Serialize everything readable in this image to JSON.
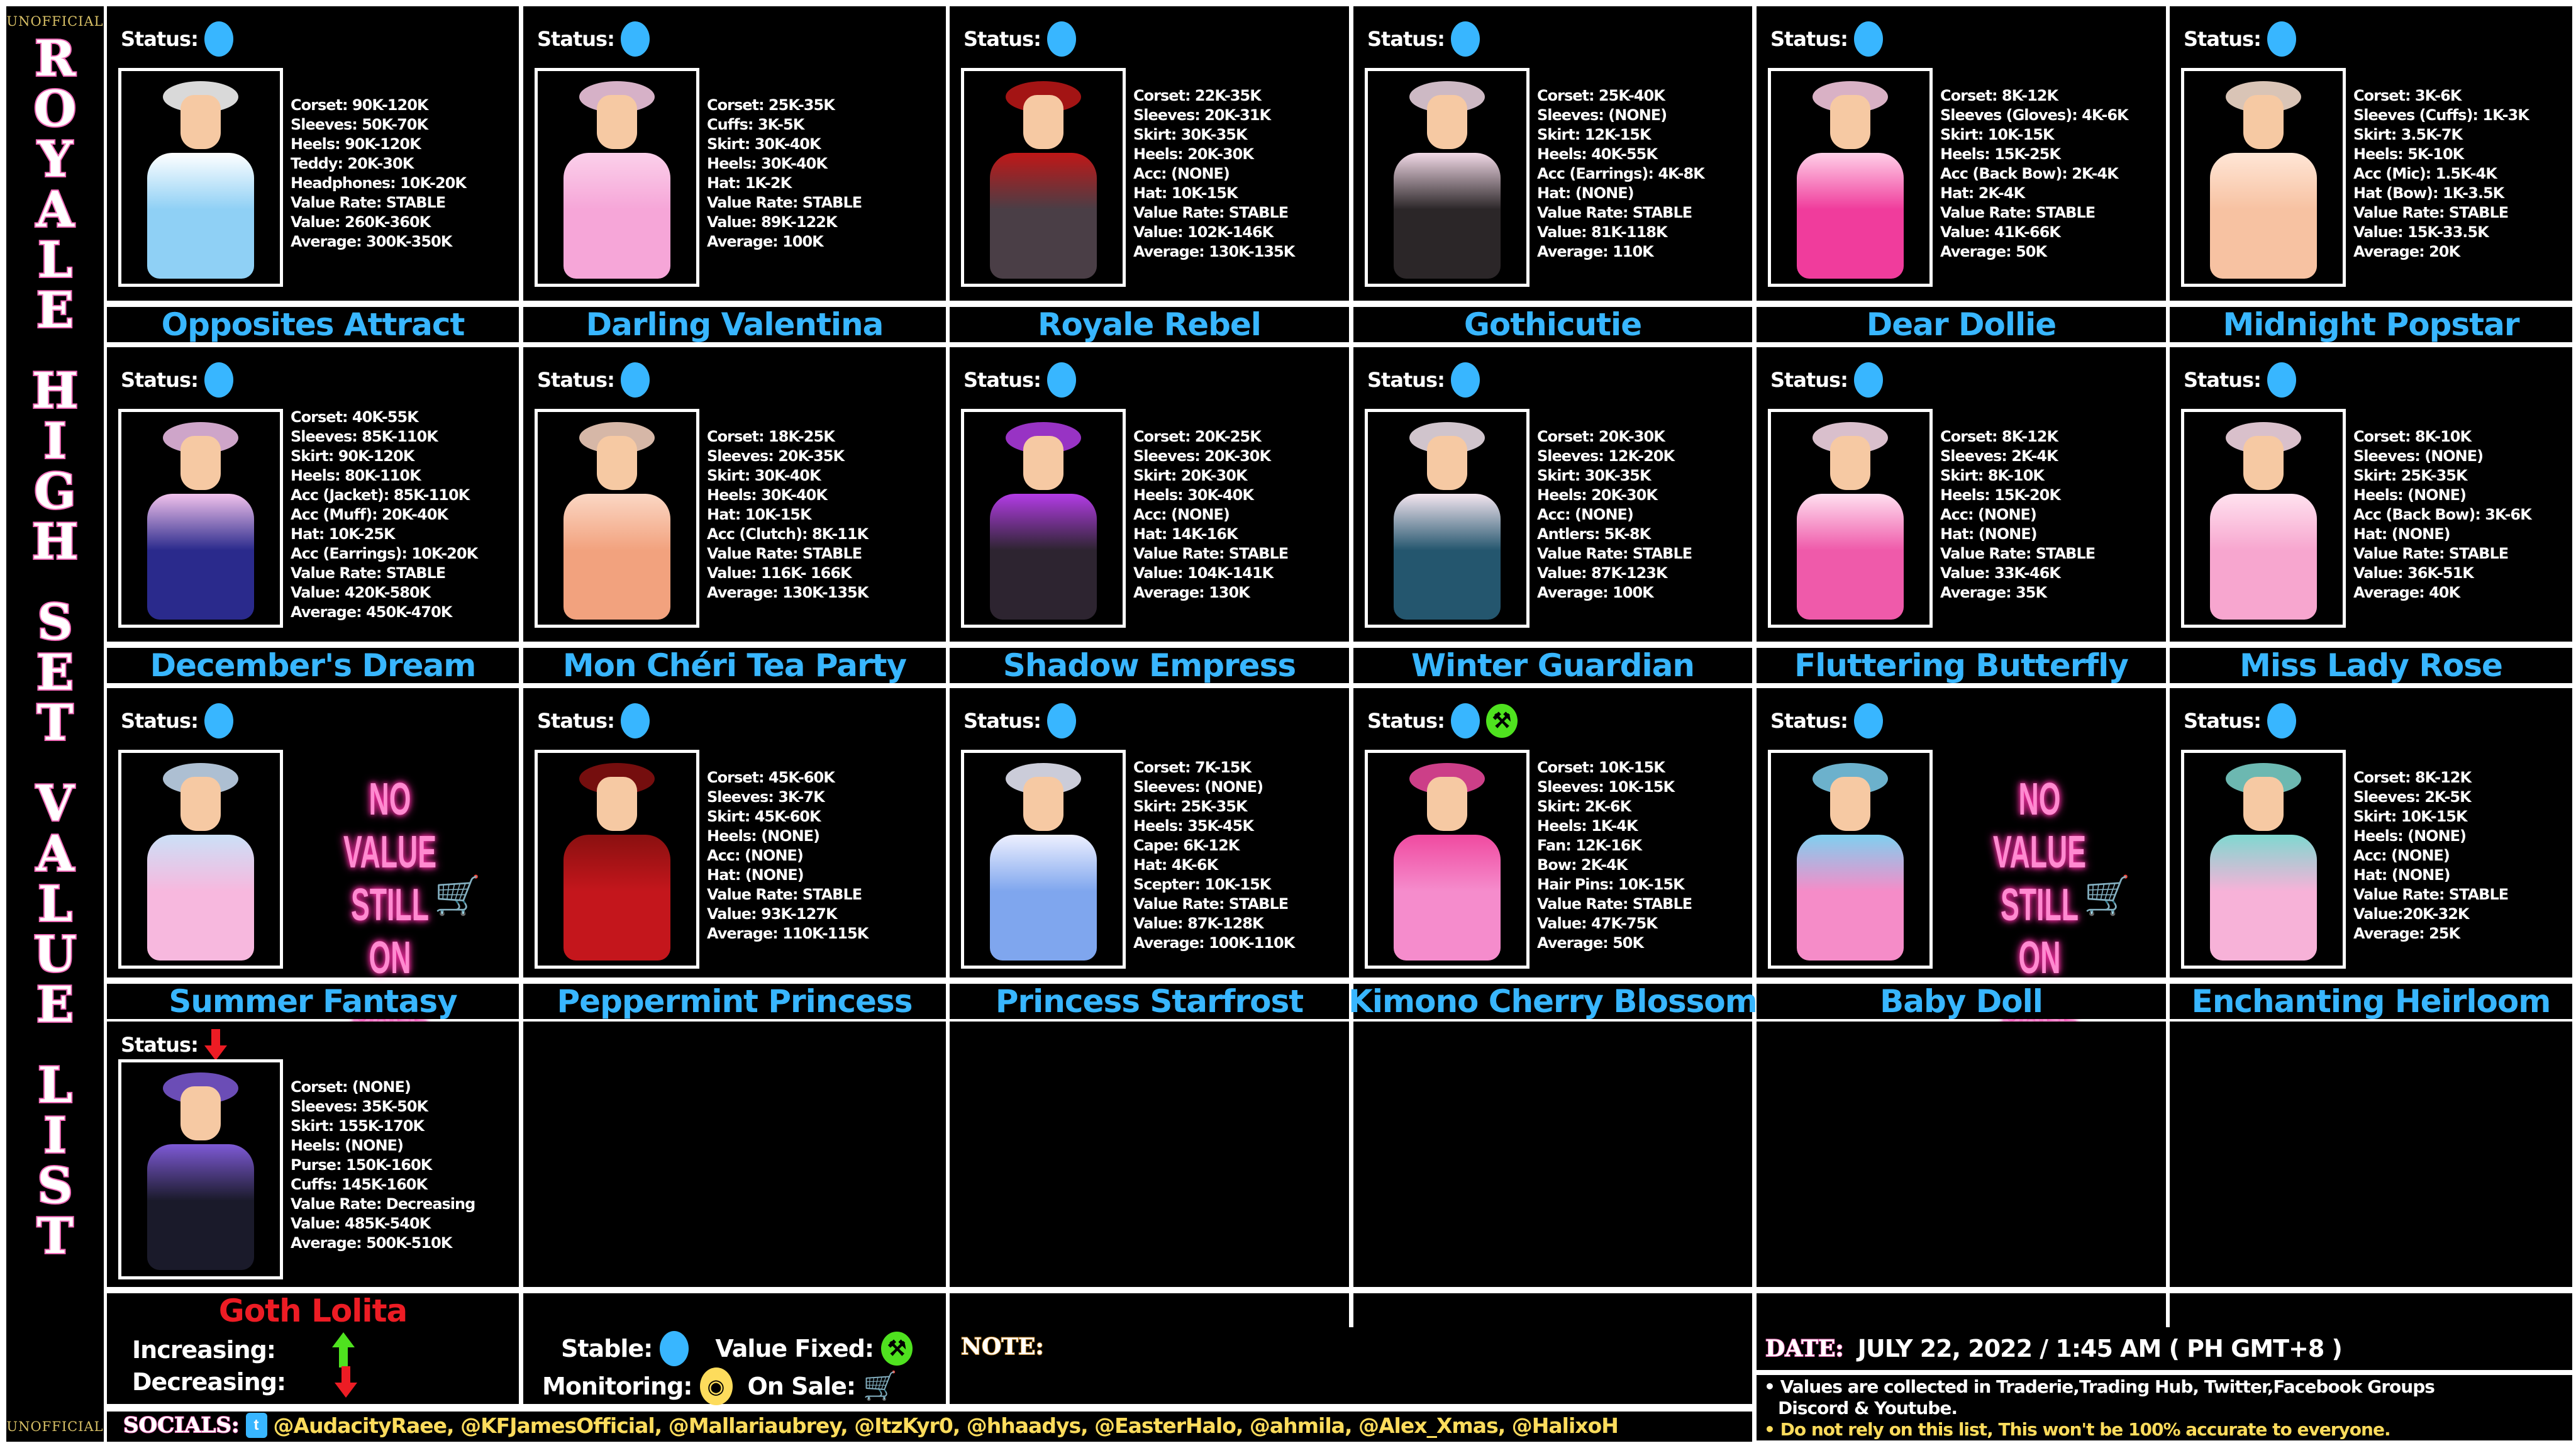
{
  "sidebar": {
    "top_label": "UNOFFICIAL",
    "bottom_label": "UNOFFICIAL",
    "title_words": [
      "ROYALE",
      "HIGH",
      "SET",
      "VALUE",
      "LIST"
    ]
  },
  "status_label": "Status:",
  "colors": {
    "stable": "#38b6ff",
    "value_fixed": "#4fe21f",
    "monitoring": "#fddc5c",
    "on_sale": "#fddc5c",
    "increasing": "#4fe21f",
    "decreasing": "#ed1c24",
    "set_name": "#38b6ff",
    "set_name_decreasing": "#ed1c24",
    "title_outline": "#f06ab8",
    "no_value_text": "#ff8ad0"
  },
  "no_value_text": [
    "NO VALUE",
    "STILL ON",
    "SALE"
  ],
  "sets": [
    {
      "name": "Opposites Attract",
      "status": [
        "stable"
      ],
      "outfit_colors": [
        "#8fd0f5",
        "#ffffff"
      ],
      "stats": [
        "Corset: 90K-120K",
        "Sleeves: 50K-70K",
        "Heels: 90K-120K",
        "Teddy: 20K-30K",
        "Headphones: 10K-20K",
        "Value Rate: STABLE",
        "Value: 260K-360K",
        "Average: 300K-350K"
      ]
    },
    {
      "name": "Darling Valentina",
      "status": [
        "stable"
      ],
      "outfit_colors": [
        "#f6a6d8",
        "#fbd0ea"
      ],
      "stats": [
        "Corset: 25K-35K",
        "Cuffs: 3K-5K",
        "Skirt: 30K-40K",
        "Heels: 30K-40K",
        "Hat: 1K-2K",
        "Value Rate: STABLE",
        "Value: 89K-122K",
        "Average: 100K"
      ]
    },
    {
      "name": "Royale Rebel",
      "status": [
        "stable"
      ],
      "outfit_colors": [
        "#4a3e46",
        "#c01717"
      ],
      "stats": [
        "Corset: 22K-35K",
        "Sleeves: 20K-31K",
        "Skirt: 30K-35K",
        "Heels: 20K-30K",
        "Acc: (NONE)",
        "Hat: 10K-15K",
        "Value Rate: STABLE",
        "Value: 102K-146K",
        "Average: 130K-135K"
      ]
    },
    {
      "name": "Gothicutie",
      "status": [
        "stable"
      ],
      "outfit_colors": [
        "#2b2628",
        "#f1d9e6"
      ],
      "stats": [
        "Corset: 25K-40K",
        "Sleeves: (NONE)",
        "Skirt: 12K-15K",
        "Heels: 40K-55K",
        "Acc (Earrings): 4K-8K",
        "Hat: (NONE)",
        "Value Rate: STABLE",
        "Value: 81K-118K",
        "Average: 110K"
      ]
    },
    {
      "name": "Dear Dollie",
      "status": [
        "stable"
      ],
      "outfit_colors": [
        "#f03c9c",
        "#ffd0e8"
      ],
      "stats": [
        "Corset: 8K-12K",
        "Sleeves (Gloves): 4K-6K",
        "Skirt: 10K-15K",
        "Heels: 15K-25K",
        "Acc (Back Bow): 2K-4K",
        "Hat: 2K-4K",
        "Value Rate: STABLE",
        "Value: 41K-66K",
        "Average: 50K"
      ]
    },
    {
      "name": "Midnight Popstar",
      "status": [
        "stable"
      ],
      "outfit_colors": [
        "#f7c2a2",
        "#ffe6d6"
      ],
      "stats": [
        "Corset: 3K-6K",
        "Sleeves (Cuffs): 1K-3K",
        "Skirt: 3.5K-7K",
        "Heels: 5K-10K",
        "Acc (Mic): 1.5K-4K",
        "Hat (Bow): 1K-3.5K",
        "Value Rate: STABLE",
        "Value: 15K-33.5K",
        "Average: 20K"
      ]
    },
    {
      "name": "December's Dream",
      "status": [
        "stable"
      ],
      "outfit_colors": [
        "#2a2a8c",
        "#f2c2ec"
      ],
      "stats": [
        "Corset: 40K-55K",
        "Sleeves: 85K-110K",
        "Skirt: 90K-120K",
        "Heels: 80K-110K",
        "Acc (Jacket): 85K-110K",
        "Acc (Muff): 20K-40K",
        "Hat: 10K-25K",
        "Acc (Earrings): 10K-20K",
        "Value Rate: STABLE",
        "Value: 420K-580K",
        "Average: 450K-470K"
      ]
    },
    {
      "name": "Mon Chéri Tea Party",
      "status": [
        "stable"
      ],
      "outfit_colors": [
        "#f2a27e",
        "#fbd7c4"
      ],
      "stats": [
        "Corset: 18K-25K",
        "Sleeves: 20K-35K",
        "Skirt: 30K-40K",
        "Heels: 30K-40K",
        "Hat: 10K-15K",
        "Acc (Clutch): 8K-11K",
        "Value Rate: STABLE",
        "Value: 116K- 166K",
        "Average: 130K-135K"
      ]
    },
    {
      "name": "Shadow Empress",
      "status": [
        "stable"
      ],
      "outfit_colors": [
        "#2d2430",
        "#b33ce6"
      ],
      "stats": [
        "Corset: 20K-25K",
        "Sleeves: 20K-30K",
        "Skirt: 20K-30K",
        "Heels: 30K-40K",
        "Acc: (NONE)",
        "Hat: 14K-16K",
        "Value Rate: STABLE",
        "Value: 104K-141K",
        "Average: 130K"
      ]
    },
    {
      "name": "Winter Guardian",
      "status": [
        "stable"
      ],
      "outfit_colors": [
        "#24566e",
        "#f4e6f0"
      ],
      "stats": [
        "Corset: 20K-30K",
        "Sleeves: 12K-20K",
        "Skirt: 30K-35K",
        "Heels: 20K-30K",
        "Acc: (NONE)",
        "Antlers: 5K-8K",
        "Value Rate: STABLE",
        "Value: 87K-123K",
        "Average: 100K"
      ]
    },
    {
      "name": "Fluttering Butterfly",
      "status": [
        "stable"
      ],
      "outfit_colors": [
        "#ef5aaa",
        "#ffe0f0"
      ],
      "stats": [
        "Corset: 8K-12K",
        "Sleeves: 2K-4K",
        "Skirt: 8K-10K",
        "Heels: 15K-20K",
        "Acc: (NONE)",
        "Hat: (NONE)",
        "Value Rate: STABLE",
        "Value: 33K-46K",
        "Average: 35K"
      ]
    },
    {
      "name": "Miss Lady Rose",
      "status": [
        "stable"
      ],
      "outfit_colors": [
        "#f7a6cf",
        "#ffe2ef"
      ],
      "stats": [
        "Corset: 8K-10K",
        "Sleeves: (NONE)",
        "Skirt: 25K-35K",
        "Heels: (NONE)",
        "Acc (Back Bow): 3K-6K",
        "Hat: (NONE)",
        "Value Rate: STABLE",
        "Value: 36K-51K",
        "Average: 40K"
      ]
    },
    {
      "name": "Summer Fantasy",
      "status": [
        "stable"
      ],
      "outfit_colors": [
        "#f7b8de",
        "#cbe0f7"
      ],
      "no_value": true,
      "stats": []
    },
    {
      "name": "Peppermint Princess",
      "status": [
        "stable"
      ],
      "outfit_colors": [
        "#c4161c",
        "#8a1010"
      ],
      "stats": [
        "Corset: 45K-60K",
        "Sleeves: 3K-7K",
        "Skirt: 45K-60K",
        "Heels: (NONE)",
        "Acc: (NONE)",
        "Hat: (NONE)",
        "Value Rate: STABLE",
        "Value: 93K-127K",
        "Average: 110K-115K"
      ]
    },
    {
      "name": "Princess Starfrost",
      "status": [
        "stable"
      ],
      "outfit_colors": [
        "#7fa6ee",
        "#eef0ff"
      ],
      "stats": [
        "Corset: 7K-15K",
        "Sleeves: (NONE)",
        "Skirt: 25K-35K",
        "Heels: 35K-45K",
        "Cape: 6K-12K",
        "Hat: 4K-6K",
        "Scepter: 10K-15K",
        "Value Rate: STABLE",
        "Value: 87K-128K",
        "Average: 100K-110K"
      ]
    },
    {
      "name": "Kimono Cherry Blossom",
      "status": [
        "stable",
        "value_fixed"
      ],
      "outfit_colors": [
        "#f58ccc",
        "#f04aa0"
      ],
      "stats": [
        "Corset: 10K-15K",
        "Sleeves: 10K-15K",
        "Skirt: 2K-6K",
        "Heels: 1K-4K",
        "Fan: 12K-16K",
        "Bow: 2K-4K",
        "Hair Pins: 10K-15K",
        "Value Rate: STABLE",
        "Value: 47K-75K",
        "Average: 50K"
      ]
    },
    {
      "name": "Baby Doll",
      "status": [
        "stable"
      ],
      "outfit_colors": [
        "#f58cc8",
        "#7fd0f0"
      ],
      "no_value": true,
      "stats": []
    },
    {
      "name": "Enchanting Heirloom",
      "status": [
        "stable"
      ],
      "outfit_colors": [
        "#f7b2d8",
        "#7fd8d0"
      ],
      "stats": [
        "Corset: 8K-12K",
        "Sleeves: 2K-5K",
        "Skirt: 10K-15K",
        "Heels: (NONE)",
        "Acc: (NONE)",
        "Hat: (NONE)",
        "Value Rate: STABLE",
        "Value:20K-32K",
        "Average: 25K"
      ]
    },
    {
      "name": "Goth Lolita",
      "status": [
        "decreasing"
      ],
      "outfit_colors": [
        "#1a1a2a",
        "#7e5ad6"
      ],
      "name_color": "red",
      "stats": [
        "Corset: (NONE)",
        "Sleeves: 35K-50K",
        "Skirt: 155K-170K",
        "Heels: (NONE)",
        "Purse: 150K-160K",
        "Cuffs: 145K-160K",
        "Value Rate: Decreasing",
        "Value: 485K-540K",
        "Average: 500K-510K"
      ]
    }
  ],
  "legend": {
    "increasing_label": "Increasing:",
    "decreasing_label": "Decreasing:",
    "stable_label": "Stable:",
    "value_fixed_label": "Value Fixed:",
    "monitoring_label": "Monitoring:",
    "on_sale_label": "On Sale:"
  },
  "note": {
    "label": "NOTE:",
    "text": ""
  },
  "date": {
    "label": "DATE:",
    "value": "JULY 22, 2022 / 1:45 AM ( PH GMT+8 )"
  },
  "info": {
    "line1": "• Values are collected in Traderie,Trading Hub, Twitter,Facebook Groups",
    "line1b": "Discord & Youtube.",
    "line2": "• Do not rely on this list, This won't be 100% accurate to everyone."
  },
  "socials": {
    "label": "SOCIALS:",
    "handles": "@AudacityRaee, @KFJamesOfficial, @Mallariaubrey, @ItzKyr0, @hhaadys, @EasterHalo, @ahmila, @Alex_Xmas, @HalixoH"
  }
}
